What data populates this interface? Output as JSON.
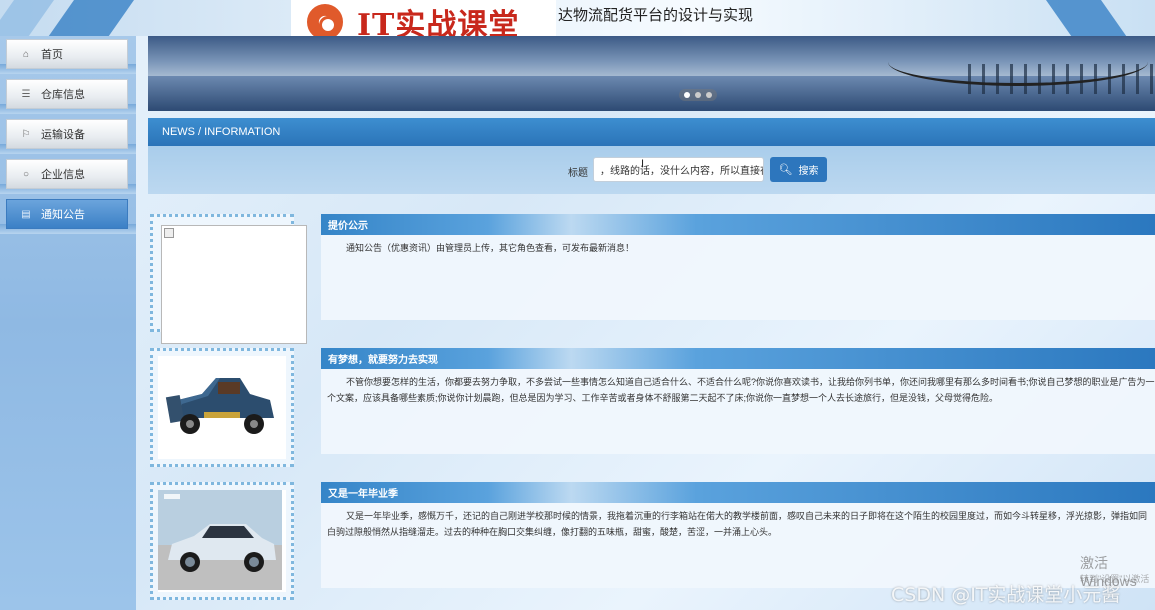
{
  "header": {
    "logo_text": "IT实战课堂",
    "site_title": "达物流配货平台的设计与实现"
  },
  "sidebar": {
    "items": [
      {
        "label": "首页",
        "icon": "home-icon",
        "glyph": "⌂"
      },
      {
        "label": "仓库信息",
        "icon": "sliders-icon",
        "glyph": "☰"
      },
      {
        "label": "运输设备",
        "icon": "flag-icon",
        "glyph": "⚐"
      },
      {
        "label": "企业信息",
        "icon": "circle-icon",
        "glyph": "○"
      },
      {
        "label": "通知公告",
        "icon": "doc-icon",
        "glyph": "▤"
      }
    ]
  },
  "news": {
    "header": "NEWS / INFORMATION",
    "search_label": "标题",
    "search_value": "，线路的话，没什么内容，所以直接在",
    "search_button": "搜索",
    "items": [
      {
        "title": "提价公示",
        "body": "通知公告（优惠资讯）由管理员上传，其它角色查看，可发布最新消息！"
      },
      {
        "title": "有梦想，就要努力去实现",
        "body": "不管你想要怎样的生活，你都要去努力争取，不多尝试一些事情怎么知道自己适合什么、不适合什么呢?你说你喜欢读书，让我给你列书单，你还问我哪里有那么多时间看书;你说自己梦想的职业是广告为一个文案，应该具备哪些素质;你说你计划晨跑，但总是因为学习、工作辛苦或者身体不舒服第二天起不了床;你说你一直梦想一个人去长途旅行，但是没钱，父母觉得危险。"
      },
      {
        "title": "又是一年毕业季",
        "body": "又是一年毕业季，感慨万千，还记的自己刚进学校那时候的情景，我拖着沉重的行李箱站在偌大的教学楼前面，感叹自己未来的日子即将在这个陌生的校园里度过，而如今斗转星移，浮光掠影，弹指如同白驹过隙般悄然从指缝溜走。过去的种种在胸口交集纠缠，像打翻的五味瓶，甜蜜，酸楚，苦涩，一并涌上心头。"
      }
    ]
  },
  "overlay": {
    "watermark": "CSDN @IT实战课堂小元酱",
    "activate": "激活 Windows",
    "activate_sub": "转到\"设置\"以激活"
  },
  "colors": {
    "accent": "#2b74b8",
    "logo_red": "#c8281c",
    "sidebar_bg": "#9cc4ea"
  }
}
